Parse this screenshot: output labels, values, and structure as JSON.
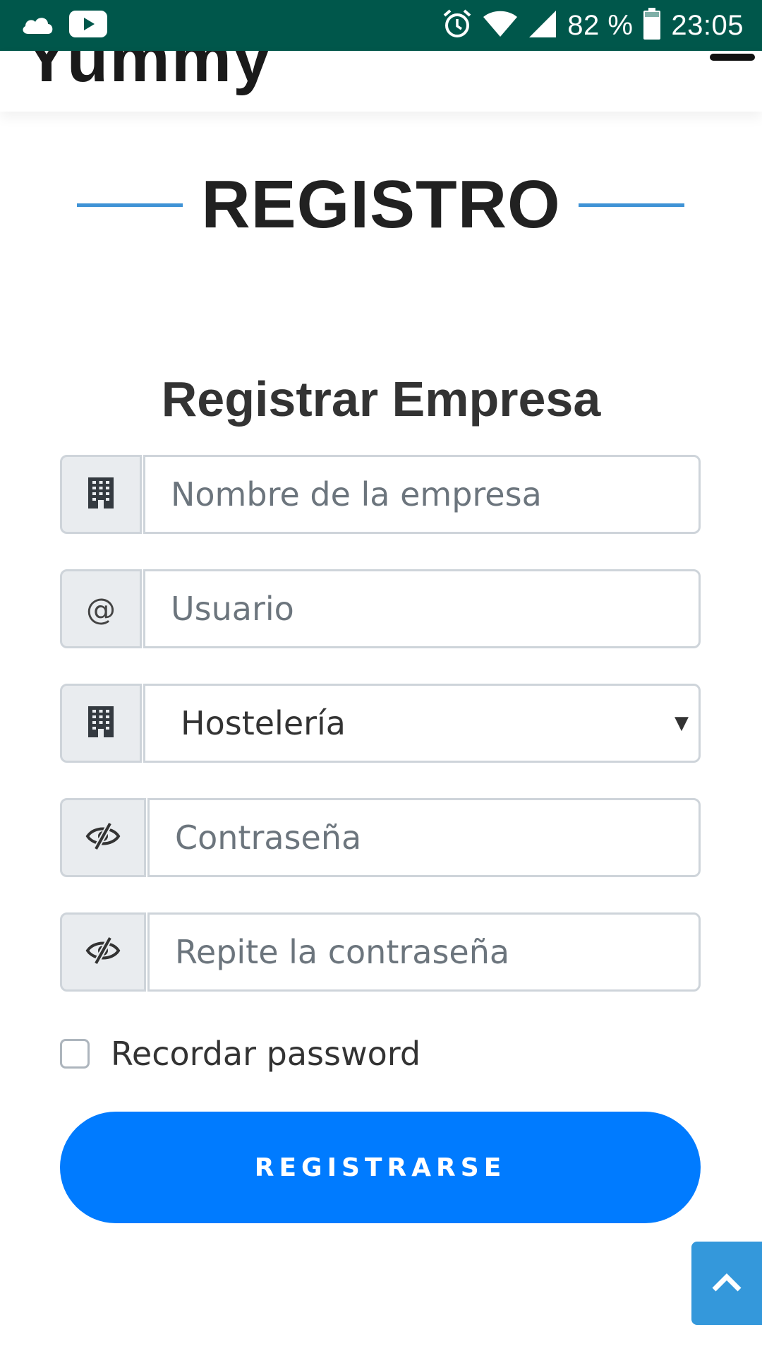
{
  "status_bar": {
    "battery_percent": "82 %",
    "time": "23:05",
    "icons": [
      "cloud-icon",
      "youtube-icon",
      "alarm-icon",
      "wifi-icon",
      "signal-icon",
      "battery-icon"
    ]
  },
  "navbar": {
    "brand": "Yummy"
  },
  "section": {
    "title": "REGISTRO"
  },
  "form": {
    "title": "Registrar Empresa",
    "company_name": {
      "placeholder": "Nombre de la empresa",
      "value": "",
      "icon": "building-icon"
    },
    "username": {
      "placeholder": "Usuario",
      "value": "",
      "addon": "@"
    },
    "sector": {
      "selected": "Hostelería",
      "icon": "building-icon"
    },
    "password": {
      "placeholder": "Contraseña",
      "value": "",
      "icon": "eye-slash-icon"
    },
    "password_repeat": {
      "placeholder": "Repite la contraseña",
      "value": "",
      "icon": "eye-slash-icon"
    },
    "remember_label": "Recordar password",
    "remember_checked": false,
    "submit_label": "REGISTRARSE"
  },
  "colors": {
    "status_bar": "#00574b",
    "accent_line": "#3f93d6",
    "primary_button": "#007bff",
    "scroll_top": "#3498db"
  }
}
